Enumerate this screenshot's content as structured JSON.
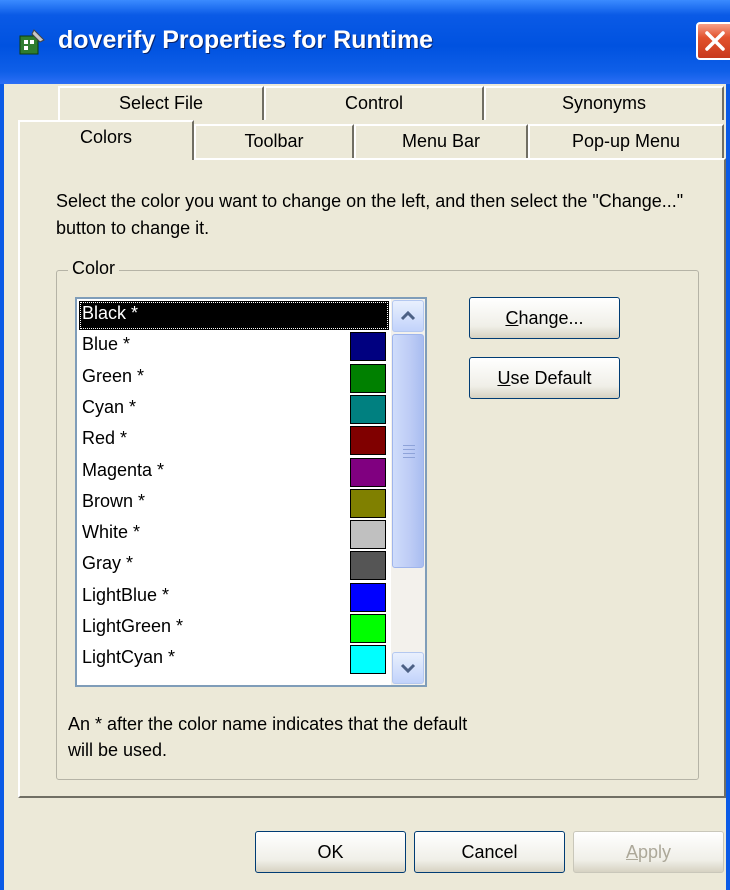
{
  "window": {
    "title": "doverify Properties for Runtime"
  },
  "tabs_back": [
    {
      "label": "Select File"
    },
    {
      "label": "Control"
    },
    {
      "label": "Synonyms"
    }
  ],
  "tabs_front": [
    {
      "label": "Colors",
      "active": true
    },
    {
      "label": "Toolbar"
    },
    {
      "label": "Menu Bar"
    },
    {
      "label": "Pop-up Menu"
    }
  ],
  "instruction": "Select the color you want to change on the left, and then select the \"Change...\" button to change it.",
  "group": {
    "label": "Color"
  },
  "colors": [
    {
      "name": "Black *",
      "hex": "#000000",
      "selected": true
    },
    {
      "name": "Blue *",
      "hex": "#000080"
    },
    {
      "name": "Green *",
      "hex": "#008000"
    },
    {
      "name": "Cyan *",
      "hex": "#008080"
    },
    {
      "name": "Red *",
      "hex": "#800000"
    },
    {
      "name": "Magenta *",
      "hex": "#800080"
    },
    {
      "name": "Brown *",
      "hex": "#808000"
    },
    {
      "name": "White *",
      "hex": "#c0c0c0"
    },
    {
      "name": "Gray *",
      "hex": "#555555"
    },
    {
      "name": "LightBlue *",
      "hex": "#0000ff"
    },
    {
      "name": "LightGreen *",
      "hex": "#00ff00"
    },
    {
      "name": "LightCyan *",
      "hex": "#00ffff"
    }
  ],
  "buttons": {
    "change_prefix": "",
    "change_mnemonic": "C",
    "change_rest": "hange...",
    "use_default_mnemonic": "U",
    "use_default_rest": "se Default",
    "ok": "OK",
    "cancel": "Cancel",
    "apply_mnemonic": "A",
    "apply_rest": "pply"
  },
  "footnote": "An * after the color name indicates that the default will be used.",
  "icons": {
    "app": "app-icon",
    "close": "close-icon",
    "scroll_up": "chevron-up-icon",
    "scroll_down": "chevron-down-icon"
  }
}
